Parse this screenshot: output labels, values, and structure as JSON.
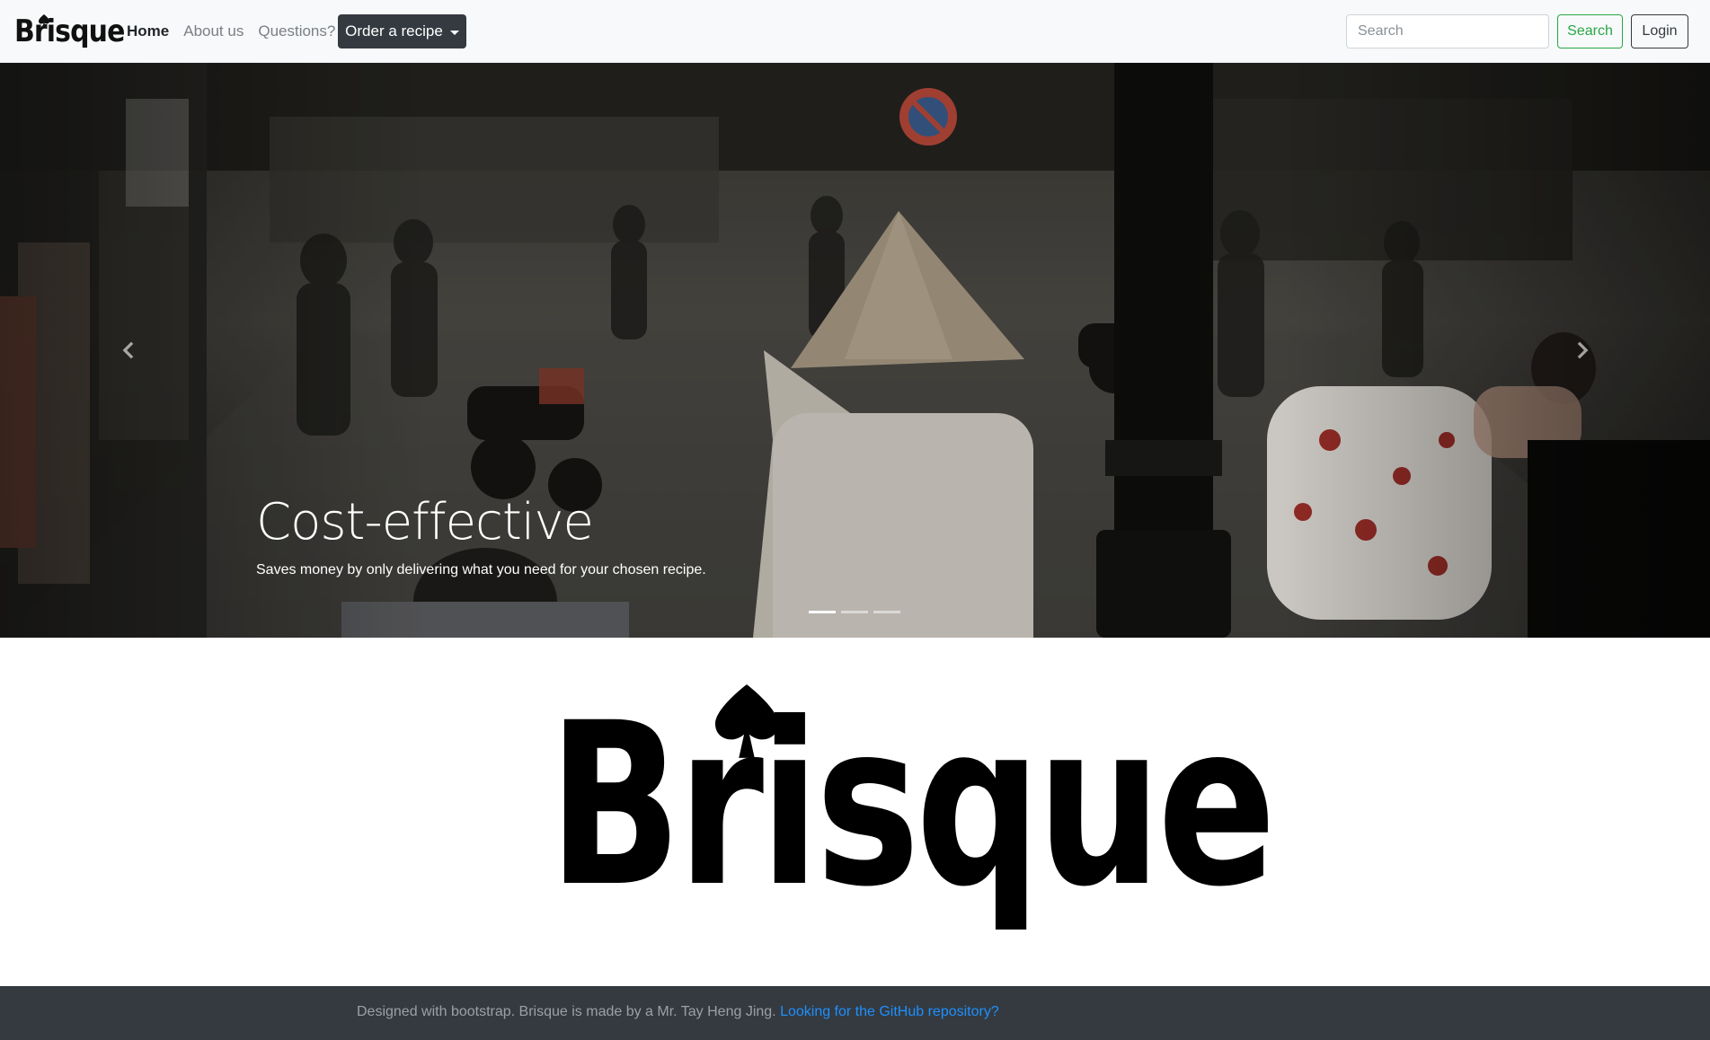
{
  "navbar": {
    "brand": "Brisque",
    "links": [
      {
        "label": "Home",
        "active": true
      },
      {
        "label": "About us",
        "active": false
      },
      {
        "label": "Questions?",
        "active": false
      }
    ],
    "order_label": "Order a recipe",
    "search_placeholder": "Search",
    "search_button": "Search",
    "login_button": "Login"
  },
  "carousel": {
    "slide_title": "Cost-effective",
    "slide_text": "Saves money by only delivering what you need for your chosen recipe.",
    "slide_count": 3,
    "active_index": 0,
    "prev_icon": "chevron-left-icon",
    "next_icon": "chevron-right-icon"
  },
  "logo": {
    "text": "Brisque"
  },
  "footer": {
    "text": "Designed with bootstrap. Brisque is made by a Mr. Tay Heng Jing. ",
    "link_text": "Looking for the GitHub repository?"
  },
  "colors": {
    "navbar_bg": "#f8f9fa",
    "dark": "#343a40",
    "success": "#28a745",
    "link": "#1e90ff"
  }
}
